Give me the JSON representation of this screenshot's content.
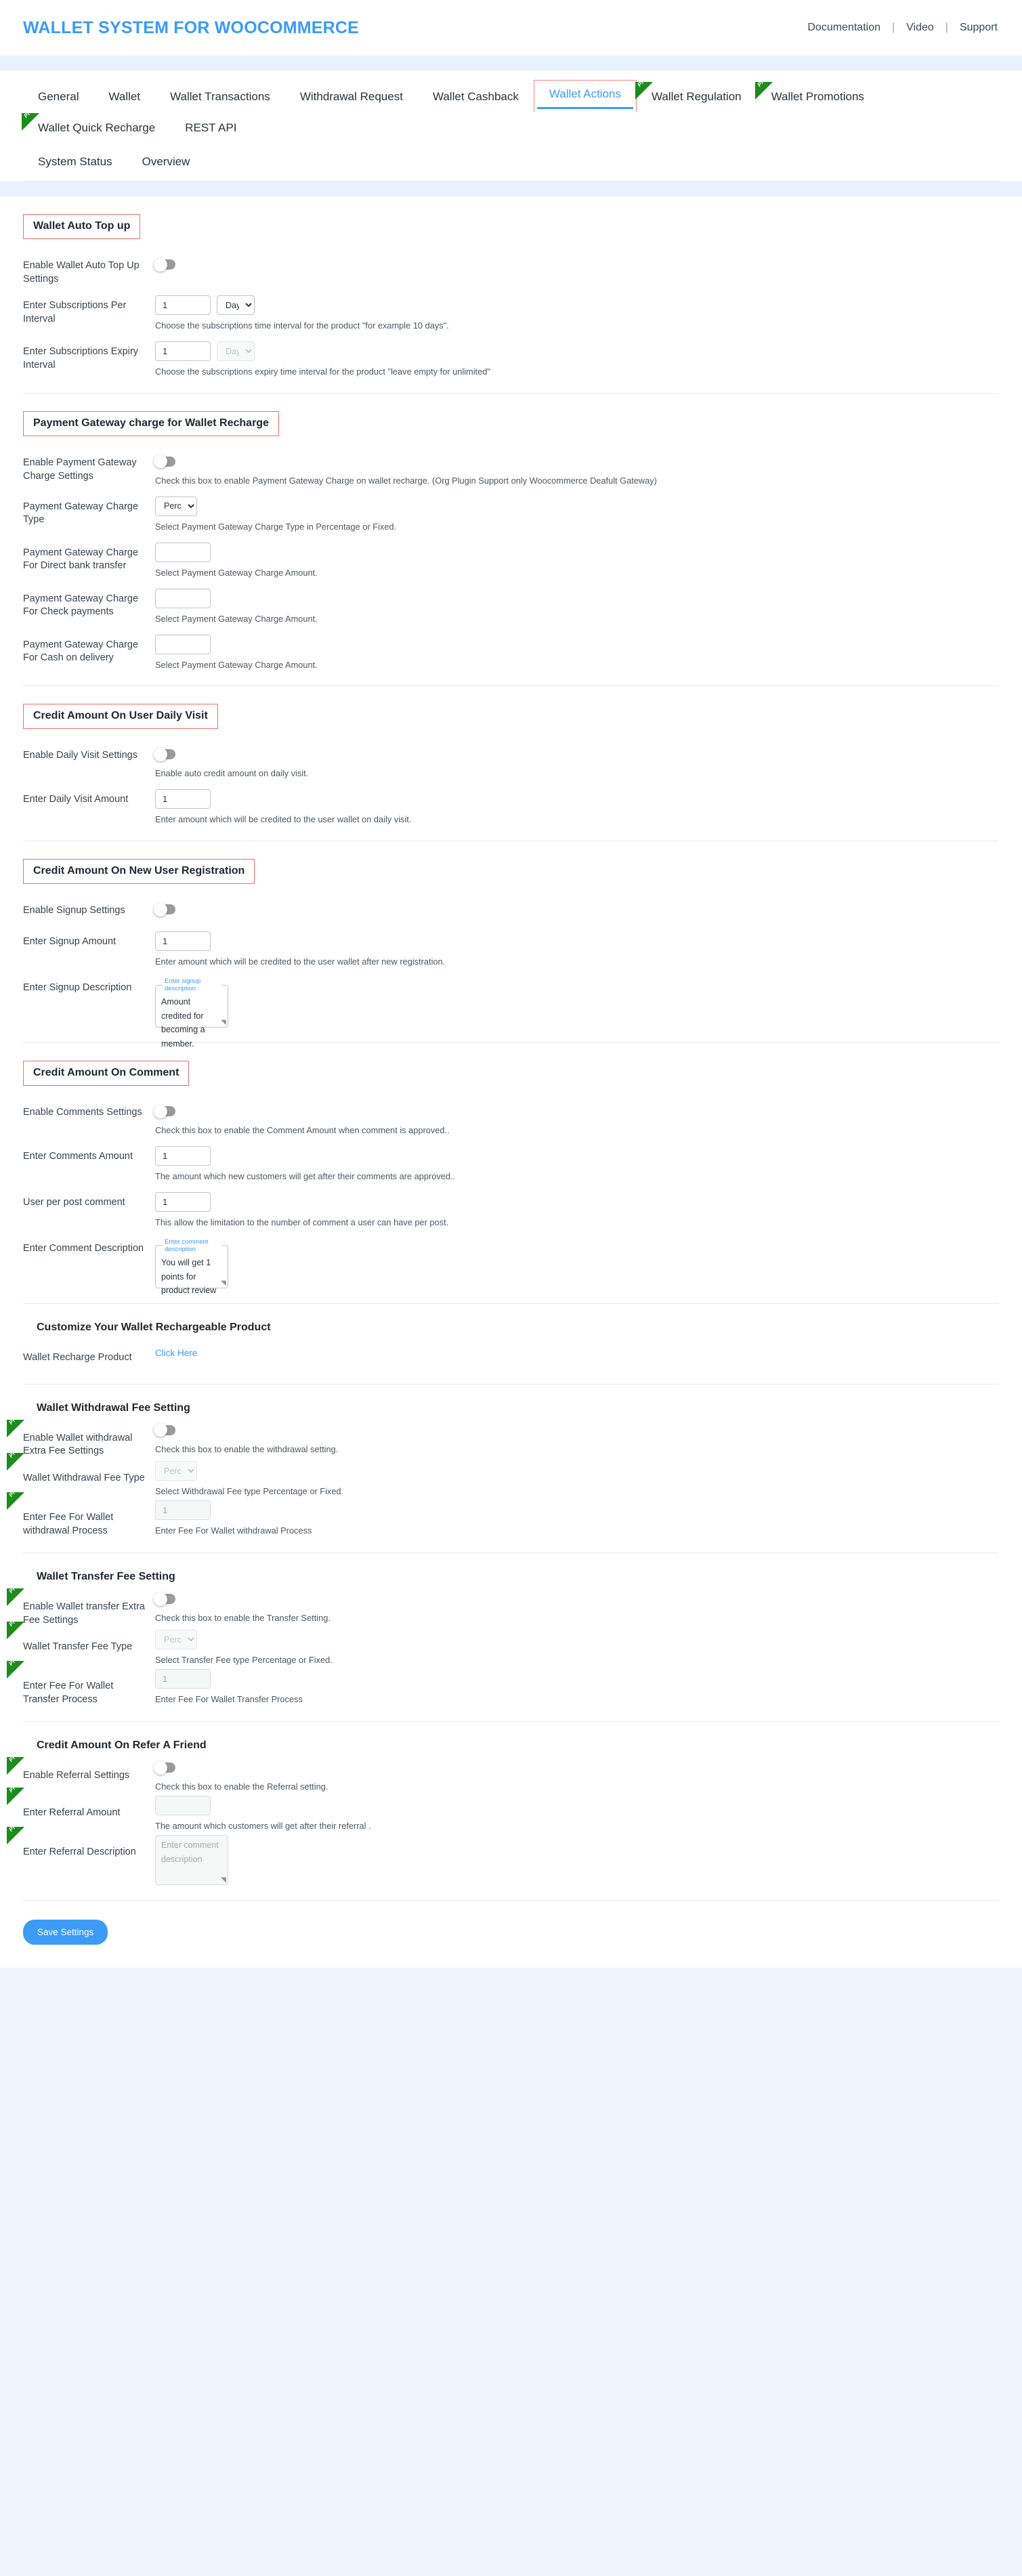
{
  "header": {
    "brand": "WALLET SYSTEM FOR WOOCOMMERCE",
    "links": [
      {
        "label": "Documentation"
      },
      {
        "label": "Video"
      },
      {
        "label": "Support"
      }
    ],
    "separator": "|"
  },
  "tabs": {
    "row1": [
      {
        "label": "General",
        "active": false,
        "pro": false
      },
      {
        "label": "Wallet",
        "active": false,
        "pro": false
      },
      {
        "label": "Wallet Transactions",
        "active": false,
        "pro": false
      },
      {
        "label": "Withdrawal Request",
        "active": false,
        "pro": false
      },
      {
        "label": "Wallet Cashback",
        "active": false,
        "pro": false
      },
      {
        "label": "Wallet Actions",
        "active": true,
        "pro": false
      },
      {
        "label": "Wallet Regulation",
        "active": false,
        "pro": true
      },
      {
        "label": "Wallet Promotions",
        "active": false,
        "pro": true
      },
      {
        "label": "Wallet Quick Recharge",
        "active": false,
        "pro": true
      },
      {
        "label": "REST API",
        "active": false,
        "pro": false
      }
    ],
    "row2": [
      {
        "label": "System Status"
      },
      {
        "label": "Overview"
      }
    ],
    "pro_badge": "Pro"
  },
  "sections": {
    "auto_topup": {
      "title": "Wallet Auto Top up",
      "enable_label": "Enable Wallet Auto Top Up Settings",
      "per_interval_label": "Enter Subscriptions Per Interval",
      "per_interval_value": "1",
      "per_interval_unit": "Days",
      "per_interval_hint": "Choose the subscriptions time interval for the product \"for example 10 days\".",
      "expiry_label": "Enter Subscriptions Expiry Interval",
      "expiry_value": "1",
      "expiry_unit": "Days",
      "expiry_hint": "Choose the subscriptions expiry time interval for the product \"leave empty for unlimited\""
    },
    "gateway": {
      "title": "Payment Gateway charge for Wallet Recharge",
      "enable_label": "Enable Payment Gateway Charge Settings",
      "enable_hint": "Check this box to enable Payment Gateway Charge on wallet recharge. (Org Plugin Support only Woocommerce Deafult Gateway)",
      "type_label": "Payment Gateway Charge Type",
      "type_value": "Percentage",
      "type_hint": "Select Payment Gateway Charge Type in Percentage or Fixed.",
      "charge_hint": "Select Payment Gateway Charge Amount.",
      "charges": [
        {
          "label": "Payment Gateway Charge For Direct bank transfer",
          "value": ""
        },
        {
          "label": "Payment Gateway Charge For Check payments",
          "value": ""
        },
        {
          "label": "Payment Gateway Charge For Cash on delivery",
          "value": ""
        }
      ]
    },
    "daily_visit": {
      "title": "Credit Amount On User Daily Visit",
      "enable_label": "Enable Daily Visit Settings",
      "enable_hint": "Enable auto credit amount on daily visit.",
      "amount_label": "Enter Daily Visit Amount",
      "amount_value": "1",
      "amount_hint": "Enter amount which will be credited to the user wallet on daily visit."
    },
    "signup": {
      "title": "Credit Amount On New User Registration",
      "enable_label": "Enable Signup Settings",
      "amount_label": "Enter Signup Amount",
      "amount_value": "1",
      "amount_hint": "Enter amount which will be credited to the user wallet after new registration.",
      "desc_label": "Enter Signup Description",
      "desc_legend": "Enter signup description",
      "desc_value": "Amount credited for becoming a member."
    },
    "comment": {
      "title": "Credit Amount On Comment",
      "enable_label": "Enable Comments Settings",
      "enable_hint": "Check this box to enable the Comment Amount when comment is approved..",
      "amount_label": "Enter Comments Amount",
      "amount_value": "1",
      "amount_hint": "The amount which new customers will get after their comments are approved..",
      "perpost_label": "User per post comment",
      "perpost_value": "1",
      "perpost_hint": "This allow the limitation to the number of comment a user can have per post.",
      "desc_label": "Enter Comment Description",
      "desc_legend": "Enter comment description",
      "desc_value": "You will get 1 points for product review"
    },
    "rechargeable": {
      "title": "Customize Your Wallet Rechargeable Product",
      "product_label": "Wallet Recharge Product",
      "link_label": "Click Here"
    },
    "withdrawal_fee": {
      "title": "Wallet Withdrawal Fee Setting",
      "enable_label": "Enable Wallet withdrawal Extra Fee Settings",
      "enable_hint": "Check this box to enable the withdrawal setting.",
      "type_label": "Wallet Withdrawal Fee Type",
      "type_value": "Percentage",
      "type_hint": "Select Withdrawal Fee type Percentage or Fixed.",
      "fee_label": "Enter Fee For Wallet withdrawal Process",
      "fee_value": "1",
      "fee_hint": "Enter Fee For Wallet withdrawal Process"
    },
    "transfer_fee": {
      "title": "Wallet Transfer Fee Setting",
      "enable_label": "Enable Wallet transfer Extra Fee Settings",
      "enable_hint": "Check this box to enable the Transfer Setting.",
      "type_label": "Wallet Transfer Fee Type",
      "type_value": "Percentage",
      "type_hint": "Select Transfer Fee type Percentage or Fixed.",
      "fee_label": "Enter Fee For Wallet Transfer Process",
      "fee_value": "1",
      "fee_hint": "Enter Fee For Wallet Transfer Process"
    },
    "referral": {
      "title": "Credit Amount On Refer A Friend",
      "enable_label": "Enable Referral Settings",
      "enable_hint": "Check this box to enable the Referral setting.",
      "amount_label": "Enter Referral Amount",
      "amount_value": "",
      "amount_hint": "The amount which customers will get after their referral .",
      "desc_label": "Enter Referral Description",
      "desc_placeholder": "Enter comment description"
    }
  },
  "footer": {
    "save_label": "Save Settings"
  },
  "colors": {
    "accent": "#3b9bf5",
    "section_border": "#f0706a",
    "pro_green": "#1a8d1a"
  }
}
